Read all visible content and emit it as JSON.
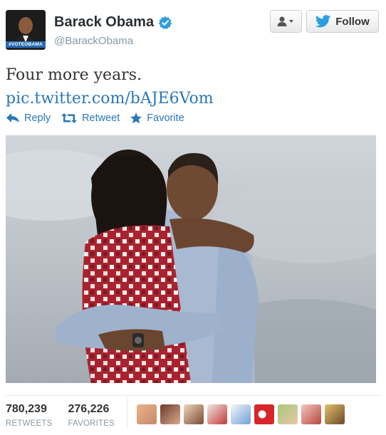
{
  "author": {
    "display_name": "Barack Obama",
    "handle": "@BarackObama",
    "avatar_tag": "#VOTEOBAMA"
  },
  "header": {
    "follow_label": "Follow"
  },
  "tweet": {
    "text": "Four more years.",
    "link": "pic.twitter.com/bAJE6Vom"
  },
  "actions": {
    "reply": "Reply",
    "retweet": "Retweet",
    "favorite": "Favorite"
  },
  "stats": {
    "retweets_count": "780,239",
    "retweets_label": "RETWEETS",
    "favorites_count": "276,226",
    "favorites_label": "FAVORITES"
  },
  "colors": {
    "link": "#2a78b6",
    "verified": "#2b9ee0",
    "twitter_bird": "#2b9ee0"
  }
}
